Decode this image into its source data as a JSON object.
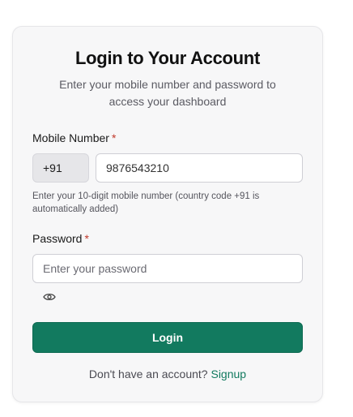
{
  "login": {
    "title": "Login to Your Account",
    "subtitle": "Enter your mobile number and password to access your dashboard",
    "mobile_label": "Mobile Number",
    "required_marker": "*",
    "country_code": "+91",
    "mobile_value": "9876543210",
    "mobile_hint": "Enter your 10-digit mobile number (country code +91 is automatically added)",
    "password_label": "Password",
    "password_placeholder": "Enter your password",
    "password_toggle_icon": "eye-icon",
    "login_button": "Login",
    "signup_prompt": "Don't have an account?",
    "signup_link": "Signup"
  },
  "colors": {
    "accent": "#127a5f",
    "required": "#c0392b",
    "card_background": "#f7f7f8"
  }
}
